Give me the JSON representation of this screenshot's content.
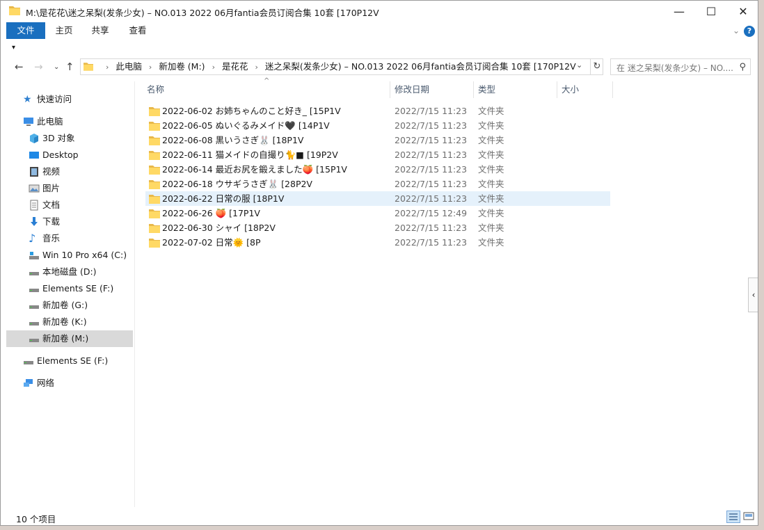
{
  "window": {
    "title": "M:\\是花花\\迷之呆梨(发条少女) – NO.013 2022 06月fantia会员订阅合集 10套 [170P12V",
    "controls": {
      "minimize": "—",
      "maximize": "☐",
      "close": "✕"
    }
  },
  "ribbon": {
    "tabs": [
      {
        "label": "文件",
        "active": true
      },
      {
        "label": "主页"
      },
      {
        "label": "共享"
      },
      {
        "label": "查看"
      }
    ],
    "help": "?",
    "qat": "▾"
  },
  "address": {
    "crumbs": [
      "此电脑",
      "新加卷 (M:)",
      "是花花",
      "迷之呆梨(发条少女) – NO.013 2022 06月fantia会员订阅合集 10套 [170P12V"
    ]
  },
  "search": {
    "placeholder": "在 迷之呆梨(发条少女) – NO...."
  },
  "sidebar": {
    "quick_access": "快速访问",
    "this_pc": "此电脑",
    "items": [
      {
        "label": "3D 对象",
        "icon": "3d-objects-icon"
      },
      {
        "label": "Desktop",
        "icon": "desktop-icon"
      },
      {
        "label": "视频",
        "icon": "video-icon"
      },
      {
        "label": "图片",
        "icon": "pictures-icon"
      },
      {
        "label": "文档",
        "icon": "documents-icon"
      },
      {
        "label": "下载",
        "icon": "download-icon"
      },
      {
        "label": "音乐",
        "icon": "music-icon"
      },
      {
        "label": "Win 10 Pro x64 (C:)",
        "icon": "system-drive-icon"
      },
      {
        "label": "本地磁盘 (D:)",
        "icon": "drive-icon"
      },
      {
        "label": "Elements SE (F:)",
        "icon": "drive-icon"
      },
      {
        "label": "新加卷 (G:)",
        "icon": "drive-icon"
      },
      {
        "label": "新加卷 (K:)",
        "icon": "drive-icon"
      },
      {
        "label": "新加卷 (M:)",
        "icon": "drive-icon",
        "selected": true
      }
    ],
    "external": "Elements SE (F:)",
    "network": "网络"
  },
  "list": {
    "columns": {
      "name": "名称",
      "date": "修改日期",
      "type": "类型",
      "size": "大小"
    },
    "rows": [
      {
        "name": "2022-06-02 お姉ちゃんのこと好き_ [15P1V",
        "date": "2022/7/15 11:23",
        "type": "文件夹"
      },
      {
        "name": "2022-06-05 ぬいぐるみメイド🖤 [14P1V",
        "date": "2022/7/15 11:23",
        "type": "文件夹"
      },
      {
        "name": "2022-06-08 黒いうさぎ🐰 [18P1V",
        "date": "2022/7/15 11:23",
        "type": "文件夹"
      },
      {
        "name": "2022-06-11 猫メイドの自撮り🐈■ [19P2V",
        "date": "2022/7/15 11:23",
        "type": "文件夹"
      },
      {
        "name": "2022-06-14 最近お尻を鍛えました🍑 [15P1V",
        "date": "2022/7/15 11:23",
        "type": "文件夹"
      },
      {
        "name": "2022-06-18 ウサギうさぎ🐰 [28P2V",
        "date": "2022/7/15 11:23",
        "type": "文件夹"
      },
      {
        "name": "2022-06-22 日常の服 [18P1V",
        "date": "2022/7/15 11:23",
        "type": "文件夹",
        "highlighted": true
      },
      {
        "name": "2022-06-26 🍑 [17P1V",
        "date": "2022/7/15 12:49",
        "type": "文件夹"
      },
      {
        "name": "2022-06-30 シャイ [18P2V",
        "date": "2022/7/15 11:23",
        "type": "文件夹"
      },
      {
        "name": "2022-07-02 日常🌞 [8P",
        "date": "2022/7/15 11:23",
        "type": "文件夹"
      }
    ]
  },
  "status": {
    "count": "10 个项目"
  },
  "colors": {
    "accent": "#1a6fbf",
    "folder": "#ffd965",
    "selection": "#e5f1fb"
  }
}
